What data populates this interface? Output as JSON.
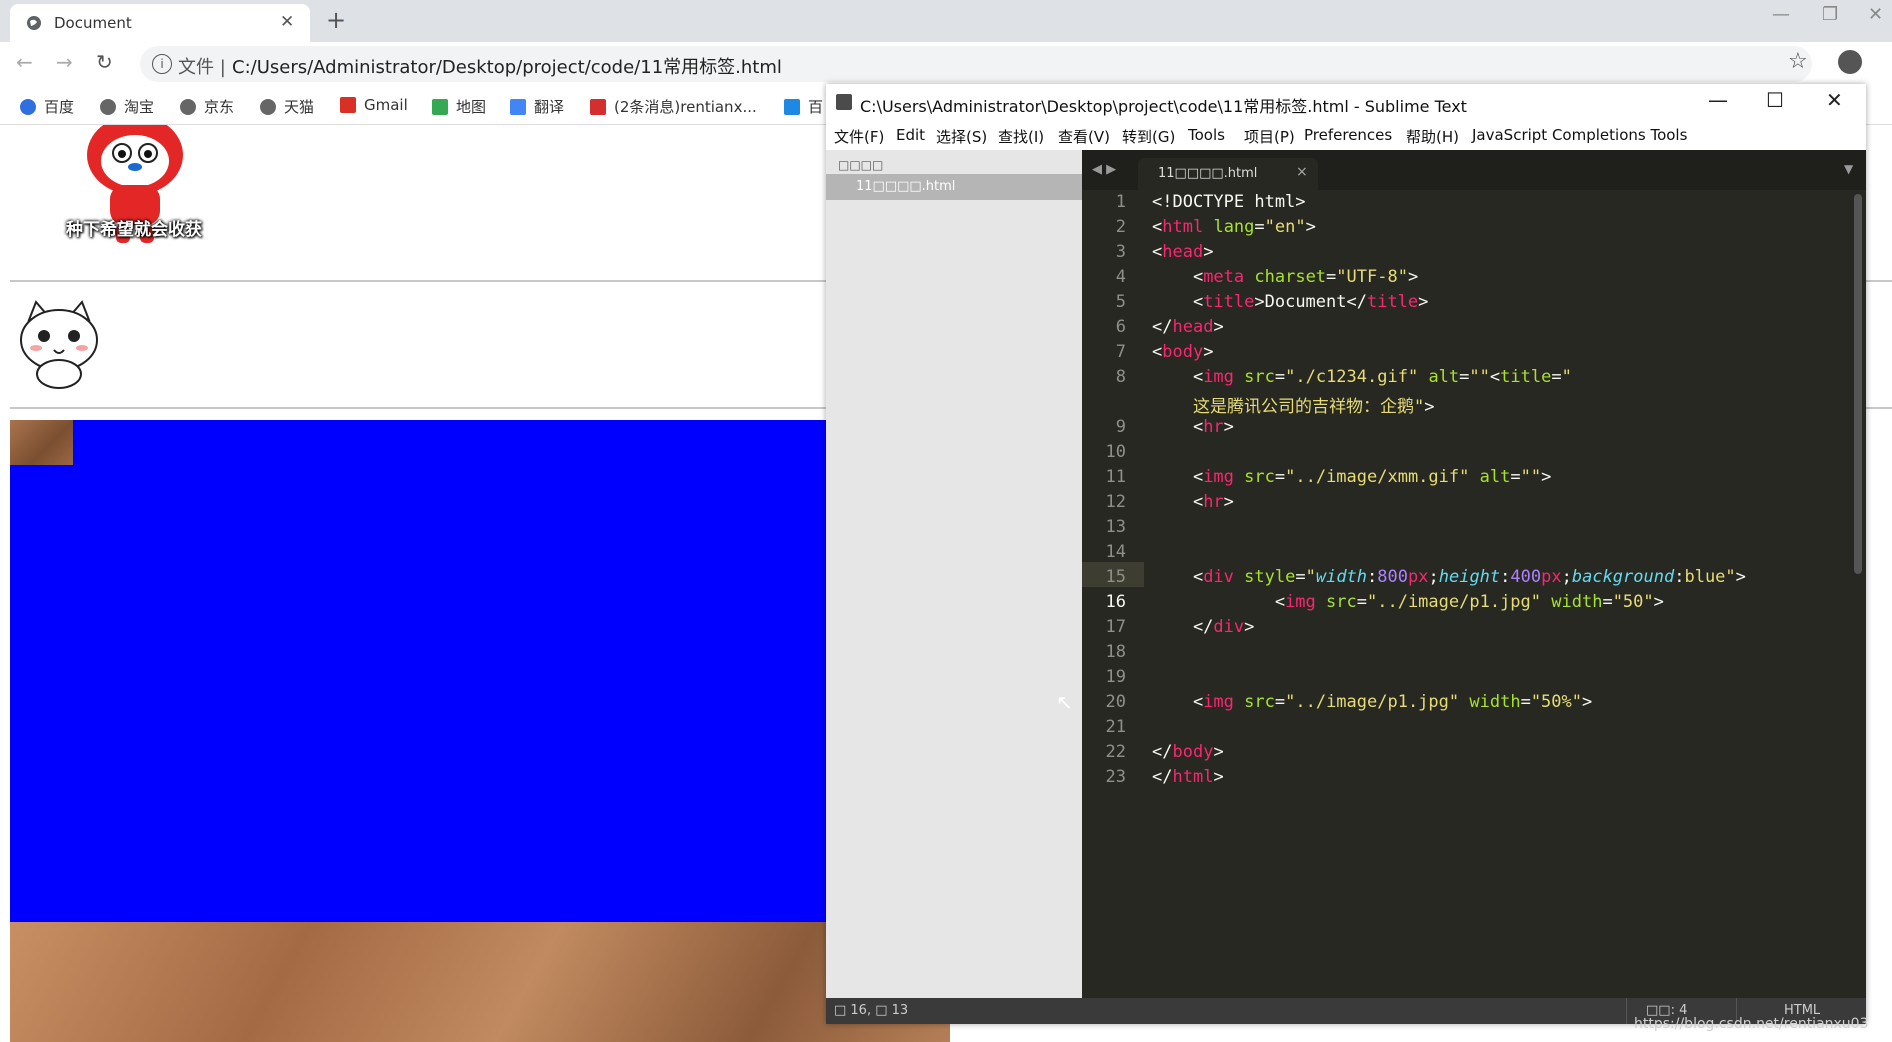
{
  "browser": {
    "tab_title": "Document",
    "tab_close": "✕",
    "new_tab": "+",
    "scheme_label": "文件 |",
    "url": "C:/Users/Administrator/Desktop/project/code/11常用标签.html",
    "bookmarks": [
      {
        "label": "百度"
      },
      {
        "label": "淘宝"
      },
      {
        "label": "京东"
      },
      {
        "label": "天猫"
      },
      {
        "label": "Gmail"
      },
      {
        "label": "地图"
      },
      {
        "label": "翻译"
      },
      {
        "label": "(2条消息)rentianx..."
      },
      {
        "label": "百"
      }
    ]
  },
  "page": {
    "penguin_caption": "种下希望就会收获"
  },
  "sublime": {
    "title": "C:\\Users\\Administrator\\Desktop\\project\\code\\11常用标签.html - Sublime Text",
    "menu": [
      "文件(F)",
      "Edit",
      "选择(S)",
      "查找(I)",
      "查看(V)",
      "转到(G)",
      "Tools",
      "项目(P)",
      "Preferences",
      "帮助(H)",
      "JavaScript Completions Tools"
    ],
    "sidebar_header": "□□□□",
    "sidebar_file": "11□□□□.html",
    "tab_name": "11□□□□.html",
    "line_numbers": [
      "1",
      "2",
      "3",
      "4",
      "5",
      "6",
      "7",
      "8",
      "",
      "9",
      "10",
      "11",
      "12",
      "13",
      "14",
      "15",
      "16",
      "17",
      "18",
      "19",
      "20",
      "21",
      "22",
      "23"
    ],
    "status_position": "□ 16, □ 13",
    "status_spaces": "□□: 4",
    "status_syntax": "HTML"
  },
  "watermark": "https://blog.csdn.net/rentianxu03"
}
